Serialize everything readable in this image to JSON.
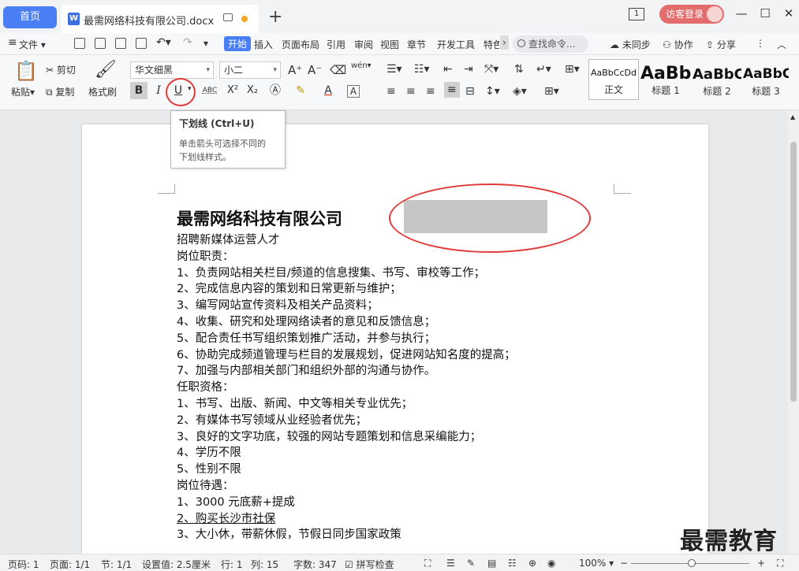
{
  "titlebar": {
    "home_tab": "首页",
    "doc_tab": "最需网络科技有限公司.docx",
    "new_tab": "+",
    "window_count": "1",
    "login": "访客登录",
    "minimize": "—",
    "maximize": "☐",
    "close": "✕"
  },
  "menu": {
    "file": "文件",
    "items": [
      "开始",
      "插入",
      "页面布局",
      "引用",
      "审阅",
      "视图",
      "章节",
      "开发工具",
      "特色"
    ],
    "search": "查找命令...",
    "unsynced": "未同步",
    "collab": "协作",
    "share": "分享"
  },
  "ribbon": {
    "paste": "粘贴",
    "cut": "剪切",
    "copy": "复制",
    "format_painter": "格式刷",
    "font_name": "华文细黑",
    "font_size": "小二",
    "bold": "B",
    "italic": "I",
    "underline": "U",
    "abc": "ABC",
    "superscript": "X²",
    "subscript": "X₂",
    "styles": [
      {
        "sample": "AaBbCcDd",
        "name": "正文"
      },
      {
        "sample": "AaBb",
        "name": "标题 1"
      },
      {
        "sample": "AaBbC",
        "name": "标题 2"
      },
      {
        "sample": "AaBbC",
        "name": "标题 3"
      }
    ]
  },
  "tooltip": {
    "title": "下划线 (Ctrl+U)",
    "desc1": "单击箭头可选择不同的",
    "desc2": "下划线样式。"
  },
  "document": {
    "title": "最需网络科技有限公司",
    "lines": [
      "招聘新媒体运营人才",
      "岗位职责：",
      "1、负责网站相关栏目/频道的信息搜集、书写、审校等工作；",
      "2、完成信息内容的策划和日常更新与维护；",
      "3、编写网站宣传资料及相关产品资料；",
      "4、收集、研究和处理网络读者的意见和反馈信息；",
      "5、配合责任书写组织策划推广活动，并参与执行；",
      "6、协助完成频道管理与栏目的发展规划，促进网站知名度的提高；",
      "7、加强与内部相关部门和组织外部的沟通与协作。",
      "任职资格：",
      "1、书写、出版、新闻、中文等相关专业优先；",
      "2、有媒体书写领域从业经验者优先；",
      "3、良好的文字功底，较强的网站专题策划和信息采编能力；",
      "4、学历不限",
      "5、性别不限",
      "岗位待遇：",
      "1、3000 元底薪+提成",
      "2、购买长沙市社保",
      "3、大小休，带薪休假，节假日同步国家政策"
    ]
  },
  "statusbar": {
    "page_no": "页码: 1",
    "pages": "页面: 1/1",
    "section": "节: 1/1",
    "position": "设置值: 2.5厘米",
    "row": "行: 1",
    "col": "列: 15",
    "words": "字数: 347",
    "spellcheck": "拼写检查",
    "zoom": "100%"
  },
  "watermark": "最需教育",
  "colors": {
    "accent": "#4a7ef5",
    "annotation": "#e03a3a",
    "login": "#e36d6d"
  }
}
